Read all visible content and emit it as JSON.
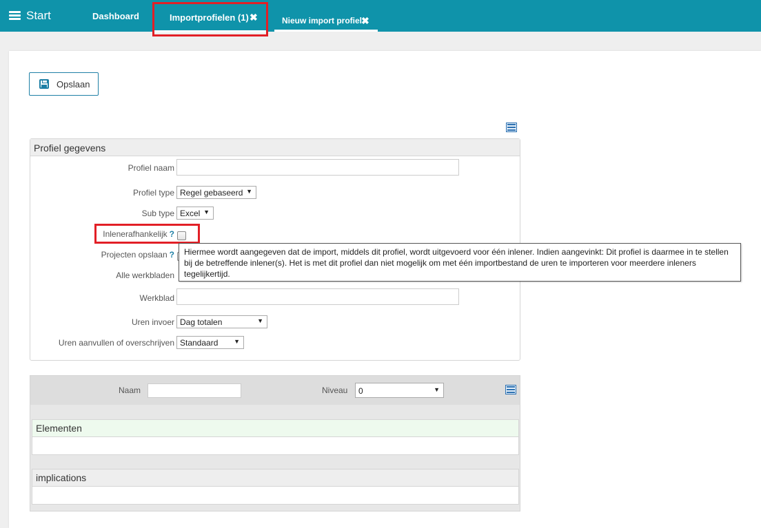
{
  "nav": {
    "start_label": "Start",
    "tabs": [
      {
        "label": "Dashboard"
      },
      {
        "label": "Importprofielen (1)"
      },
      {
        "label": "Nieuw import profiel"
      }
    ],
    "close_glyph": "✖"
  },
  "toolbar": {
    "save_label": "Opslaan"
  },
  "profile_section": {
    "title": "Profiel gegevens",
    "fields": {
      "profiel_naam": {
        "label": "Profiel naam",
        "value": ""
      },
      "profiel_type": {
        "label": "Profiel type",
        "value": "Regel gebaseerd"
      },
      "sub_type": {
        "label": "Sub type",
        "value": "Excel"
      },
      "inlenerafhankelijk": {
        "label": "Inlenerafhankelijk",
        "help": "?",
        "checked": false
      },
      "projecten_opslaan": {
        "label": "Projecten opslaan",
        "help": "?"
      },
      "alle_werkbladen": {
        "label": "Alle werkbladen"
      },
      "werkblad": {
        "label": "Werkblad",
        "value": ""
      },
      "uren_invoer": {
        "label": "Uren invoer",
        "value": "Dag totalen"
      },
      "uren_aanvullen": {
        "label": "Uren aanvullen of overschrijven",
        "value": "Standaard"
      }
    },
    "tooltip": "Hiermee wordt aangegeven dat de import, middels dit profiel, wordt uitgevoerd voor één inlener. Indien aangevinkt: Dit profiel is daarmee in te stellen bij de betreffende inlener(s). Het is met dit profiel dan niet mogelijk om met één importbestand de uren te importeren voor meerdere inleners tegelijkertijd."
  },
  "elements_panel": {
    "naam_label": "Naam",
    "naam_value": "",
    "niveau_label": "Niveau",
    "niveau_value": "0",
    "elementen_title": "Elementen",
    "implications_title": "implications"
  },
  "colors": {
    "topbar": "#0f93aa",
    "highlight": "#e21f26",
    "accent": "#1d7fa5"
  }
}
